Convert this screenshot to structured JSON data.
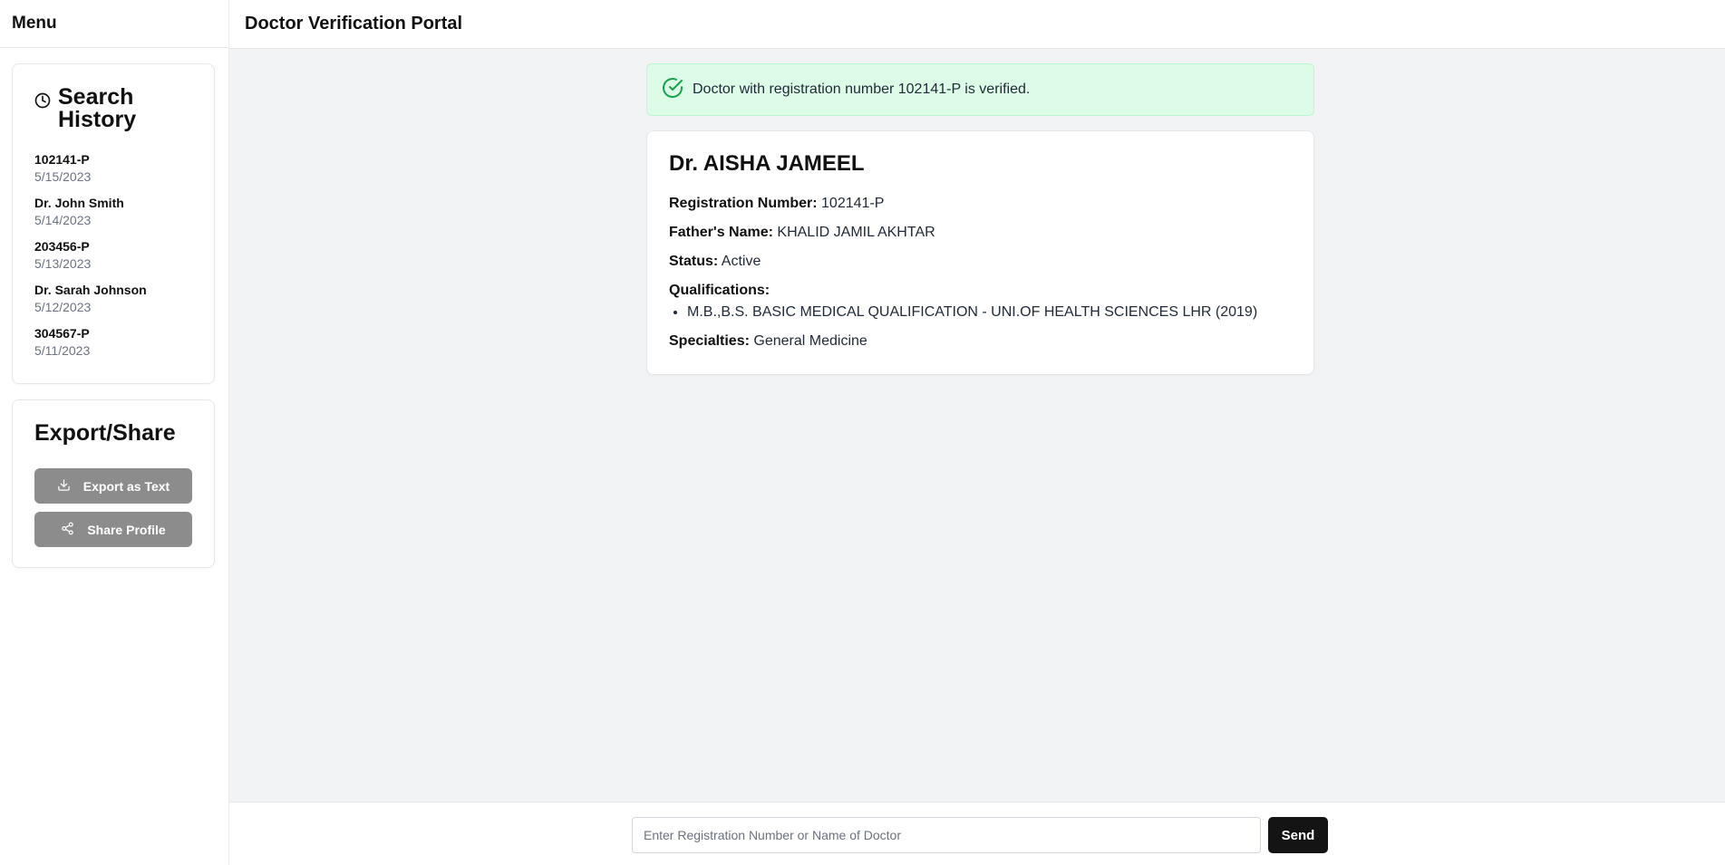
{
  "sidebar": {
    "menu_label": "Menu",
    "history": {
      "title": "Search History",
      "items": [
        {
          "name": "102141-P",
          "date": "5/15/2023"
        },
        {
          "name": "Dr. John Smith",
          "date": "5/14/2023"
        },
        {
          "name": "203456-P",
          "date": "5/13/2023"
        },
        {
          "name": "Dr. Sarah Johnson",
          "date": "5/12/2023"
        },
        {
          "name": "304567-P",
          "date": "5/11/2023"
        }
      ]
    },
    "export": {
      "title": "Export/Share",
      "export_text_label": "Export as Text",
      "share_profile_label": "Share Profile"
    }
  },
  "header": {
    "title": "Doctor Verification Portal"
  },
  "alert": {
    "message": "Doctor with registration number 102141-P is verified.",
    "icon": "check-circle-icon",
    "color": "#16a34a"
  },
  "doctor": {
    "name": "Dr. AISHA JAMEEL",
    "registration_label": "Registration Number:",
    "registration_value": "102141-P",
    "father_label": "Father's Name:",
    "father_value": "KHALID JAMIL AKHTAR",
    "status_label": "Status:",
    "status_value": "Active",
    "qualifications_label": "Qualifications:",
    "qualifications": [
      "M.B.,B.S. BASIC MEDICAL QUALIFICATION - UNI.OF HEALTH SCIENCES LHR (2019)"
    ],
    "specialties_label": "Specialties:",
    "specialties_value": "General Medicine"
  },
  "search": {
    "placeholder": "Enter Registration Number or Name of Doctor",
    "value": "",
    "send_label": "Send"
  }
}
